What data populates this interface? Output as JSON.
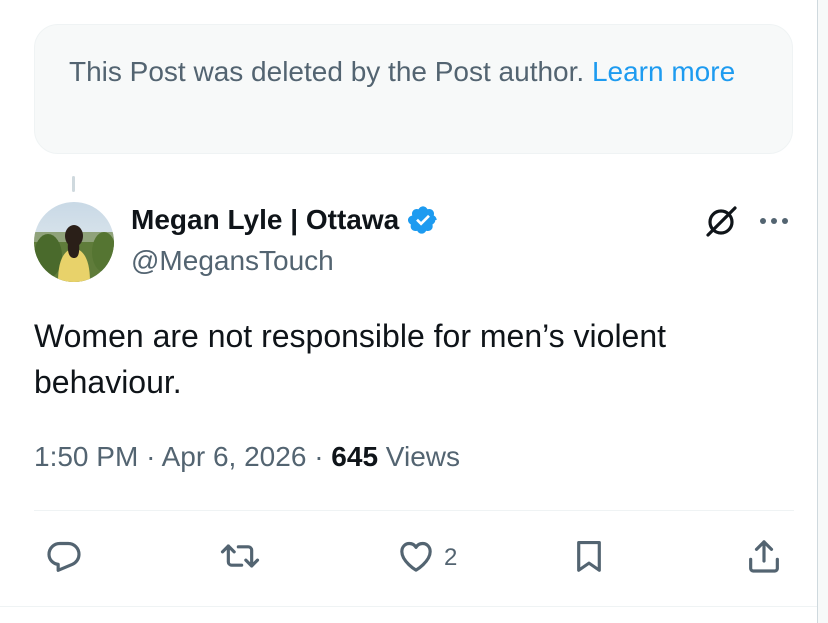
{
  "deleted_notice": {
    "text": "This Post was deleted by the Post author.",
    "learn_more": "Learn more"
  },
  "post": {
    "author_name": "Megan Lyle | Ottawa",
    "handle": "@MegansTouch",
    "text": "Women are not responsible for men’s violent behaviour.",
    "time": "1:50 PM",
    "separator": "·",
    "date": "Apr 6, 2026",
    "views_count": "645",
    "views_label": "Views"
  },
  "actions": {
    "reply_icon": "reply-icon",
    "repost_icon": "repost-icon",
    "like_icon": "heart-icon",
    "like_count": "2",
    "bookmark_icon": "bookmark-icon",
    "share_icon": "share-icon"
  },
  "colors": {
    "accent": "#1d9bf0",
    "text_primary": "#0f1419",
    "text_secondary": "#536471",
    "notice_bg": "#f7f9f9"
  }
}
